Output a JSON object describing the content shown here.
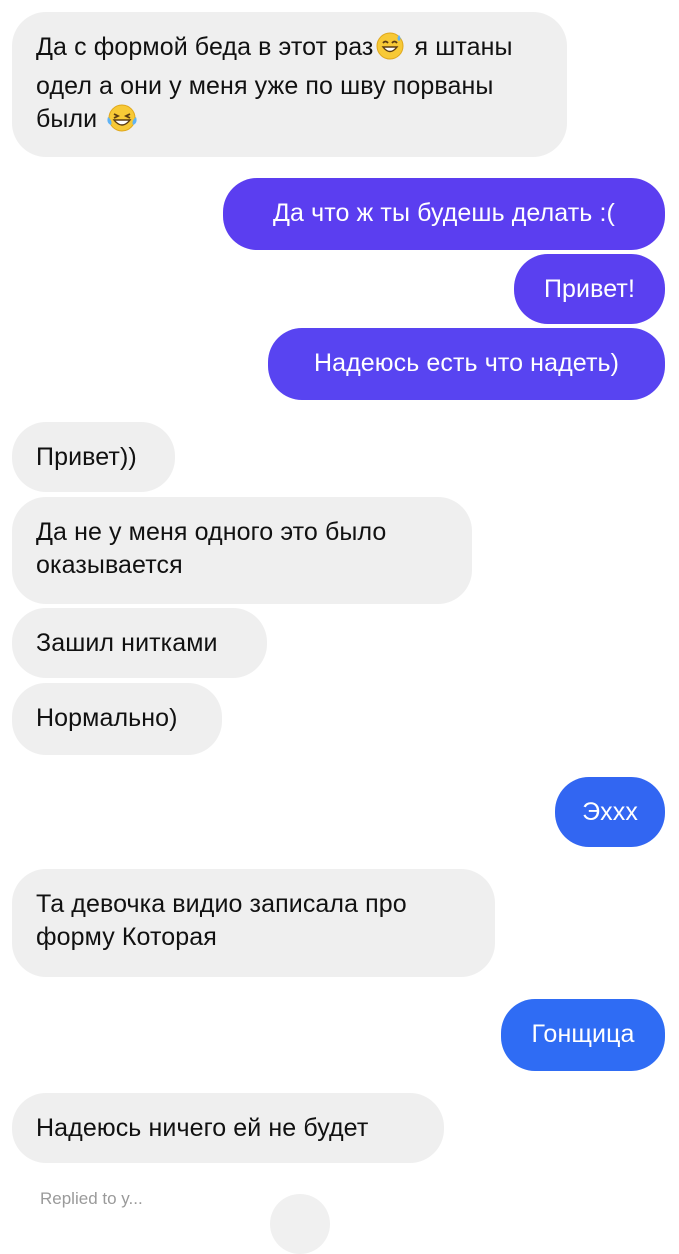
{
  "chat": {
    "colors": {
      "incoming_bg": "#efefef",
      "outgoing_purple": "#5b3ef0",
      "outgoing_blue": "#2f6cf4"
    },
    "messages": [
      {
        "direction": "incoming",
        "text_before_emoji": "Да с формой беда в этот раз",
        "emoji_1": "sweat-smile-emoji",
        "text_after_emoji": " я штаны одел а они у меня уже по шву порваны были ",
        "emoji_2": "tears-of-joy-emoji"
      },
      {
        "direction": "outgoing",
        "text": "Да что ж ты будешь делать :("
      },
      {
        "direction": "outgoing",
        "text": "Привет!"
      },
      {
        "direction": "outgoing",
        "text": "Надеюсь есть что надеть)"
      },
      {
        "direction": "incoming",
        "text": "Привет))"
      },
      {
        "direction": "incoming",
        "text": "Да не у меня одного это было оказывается"
      },
      {
        "direction": "incoming",
        "text": "Зашил нитками"
      },
      {
        "direction": "incoming",
        "text": "Нормально)"
      },
      {
        "direction": "outgoing",
        "text": "Эххх"
      },
      {
        "direction": "incoming",
        "text": "Та девочка видио записала про форму Которая"
      },
      {
        "direction": "outgoing",
        "text": "Гонщица"
      },
      {
        "direction": "incoming",
        "text": "Надеюсь ничего ей не будет"
      }
    ],
    "footer": {
      "cutoff_text": "Replied to y..."
    }
  }
}
